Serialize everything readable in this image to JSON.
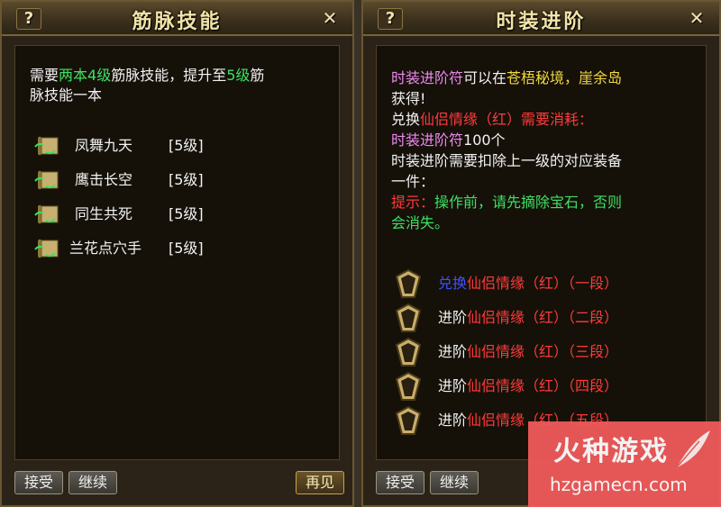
{
  "left_panel": {
    "title": "筋脉技能",
    "help": "?",
    "close": "✕",
    "desc": {
      "p1": "需要",
      "p2": "两本4级",
      "p3": "筋脉技能，提升至",
      "p4": "5级",
      "p5": "筋",
      "line2": "脉技能一本"
    },
    "skills": [
      {
        "name": "凤舞九天",
        "level": "[5级]"
      },
      {
        "name": "鹰击长空",
        "level": "[5级]"
      },
      {
        "name": "同生共死",
        "level": "[5级]"
      },
      {
        "name": "兰花点穴手",
        "level": "[5级]"
      }
    ],
    "buttons": {
      "accept": "接受",
      "continue": "继续",
      "goodbye": "再见"
    }
  },
  "right_panel": {
    "title": "时装进阶",
    "help": "?",
    "close": "✕",
    "desc": {
      "l1a": "时装进阶符",
      "l1b": "可以在",
      "l1c": "苍梧秘境，崖余岛",
      "l2": "获得!",
      "l3a": "兑换",
      "l3b": "仙侣情缘（红）需要消耗：",
      "l4a": "时装进阶符",
      "l4b": "100个",
      "l5": "时装进阶需要扣除上一级的对应装备",
      "l6": "一件：",
      "l7a": "提示：",
      "l7b": "操作前，请先摘除宝石，否则",
      "l8": "会消失。"
    },
    "options": [
      {
        "verb": "兑换",
        "item": "仙侣情缘（红）（一段）"
      },
      {
        "verb": "进阶",
        "item": "仙侣情缘（红）（二段）"
      },
      {
        "verb": "进阶",
        "item": "仙侣情缘（红）（三段）"
      },
      {
        "verb": "进阶",
        "item": "仙侣情缘（红）（四段）"
      },
      {
        "verb": "进阶",
        "item": "仙侣情缘（红）（五段）"
      }
    ],
    "buttons": {
      "accept": "接受",
      "continue": "继续"
    }
  },
  "watermark": {
    "brand": "火种游戏",
    "url": "hzgamecn.com"
  }
}
